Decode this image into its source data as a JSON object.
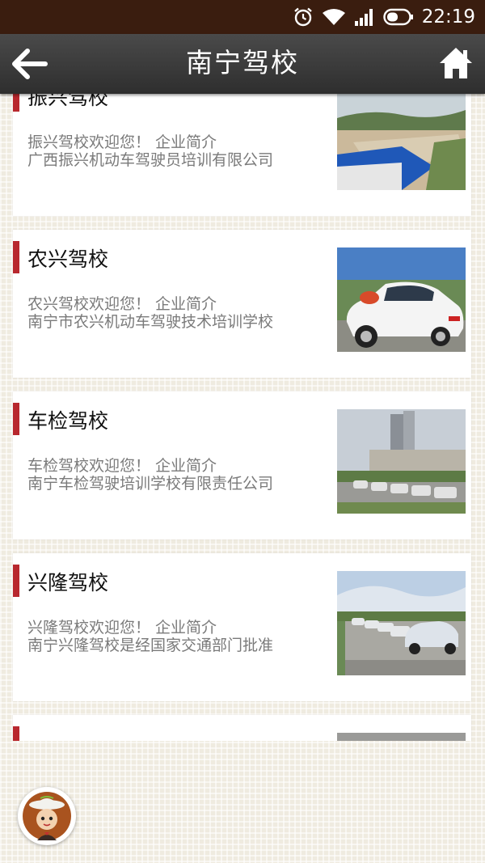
{
  "status_bar": {
    "time": "22:19"
  },
  "app_bar": {
    "title": "南宁驾校"
  },
  "schools": [
    {
      "title": "振兴驾校",
      "line1": "振兴驾校欢迎您！ 企业简介",
      "line2": "广西振兴机动车驾驶员培训有限公司",
      "line3": ""
    },
    {
      "title": "农兴驾校",
      "line1": "农兴驾校欢迎您！ 企业简介",
      "line2": "南宁市农兴机动车驾驶技术培训学校",
      "line3": ""
    },
    {
      "title": "车检驾校",
      "line1": "车检驾校欢迎您！ 企业简介",
      "line2": "南宁车检驾驶培训学校有限责任公司",
      "line3": ""
    },
    {
      "title": "兴隆驾校",
      "line1": "兴隆驾校欢迎您！ 企业简介",
      "line2": "南宁兴隆驾校是经国家交通部门批准",
      "line3": ""
    },
    {
      "title": "",
      "line1": "",
      "line2": "",
      "line3": ""
    }
  ],
  "icons": {
    "alarm": "alarm-icon",
    "wifi": "wifi-icon",
    "signal": "signal-icon",
    "battery": "battery-icon",
    "back": "back-arrow-icon",
    "home": "home-icon",
    "assistant": "assistant-avatar-icon"
  },
  "colors": {
    "accent": "#b8282e",
    "app_bar": "#3a3a3a",
    "status_bar": "#3a1d0f"
  }
}
